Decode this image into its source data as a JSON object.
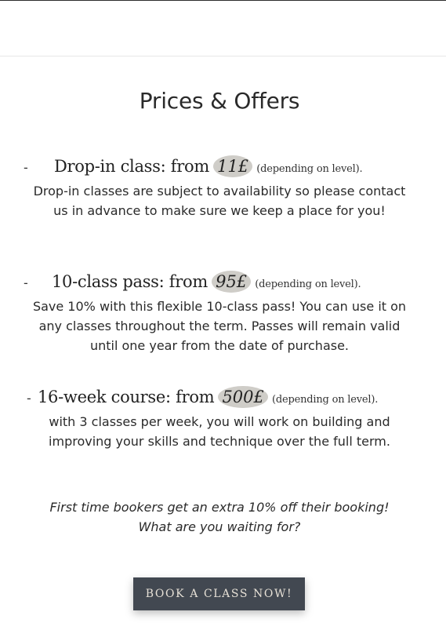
{
  "section": {
    "title": "Prices & Offers"
  },
  "offers": [
    {
      "dash": "-",
      "name": "Drop-in class: from",
      "price": "11£",
      "note": "(depending on level).",
      "description": "Drop-in classes are subject to availability so please contact us in advance to make sure we keep a place for you!"
    },
    {
      "dash": "-",
      "name": "10-class pass: from",
      "price": "95£",
      "note": "(depending on level).",
      "description": "Save 10% with this flexible 10-class pass! You can use it on any classes throughout the term. Passes will remain valid until one year from the date of purchase."
    },
    {
      "dash": "-",
      "name": "16-week course: from",
      "price": "500£",
      "note": "(depending on level).",
      "description": "with 3 classes per week, you will work on building and improving your skills and technique over the full term."
    }
  ],
  "promo": {
    "line1": "First time bookers get an extra 10% off their booking!",
    "line2": "What are you waiting for?"
  },
  "cta": {
    "label": "Book a class now!"
  },
  "colors": {
    "button_bg": "#424851",
    "button_text": "#e6e0d6",
    "price_highlight": "#cfcdc8",
    "text": "#2a2a2a"
  }
}
